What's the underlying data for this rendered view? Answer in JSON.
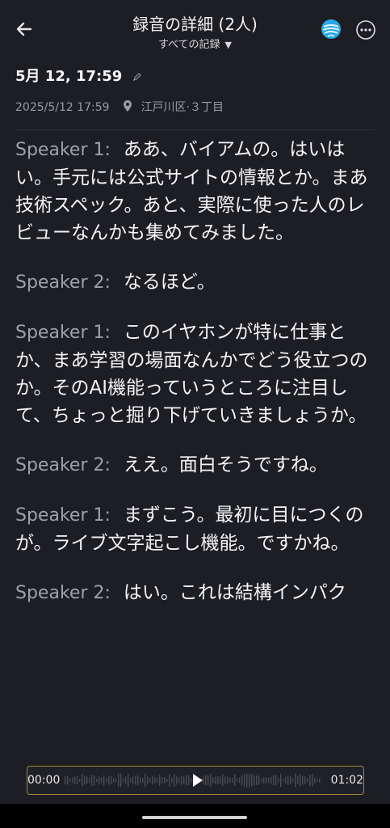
{
  "header": {
    "title": "録音の詳細 (2人)",
    "subtitle": "すべての記録",
    "icons": [
      "back-arrow-icon",
      "caret-down-icon",
      "app-logo-icon",
      "more-icon"
    ]
  },
  "recording": {
    "title": "5月 12, 17:59",
    "datetime": "2025/5/12 17:59",
    "location": "江戸川区·３丁目"
  },
  "transcript": [
    {
      "speaker": "Speaker 1:",
      "text": "ああ、バイアムの。はいはい。手元には公式サイトの情報とか。まあ技術スペック。あと、実際に使った人のレビューなんかも集めてみました。"
    },
    {
      "speaker": "Speaker 2:",
      "text": "なるほど。"
    },
    {
      "speaker": "Speaker 1:",
      "text": "このイヤホンが特に仕事とか、まあ学習の場面なんかでどう役立つのか。そのAI機能っていうところに注目して、ちょっと掘り下げていきましょうか。"
    },
    {
      "speaker": "Speaker 2:",
      "text": "ええ。面白そうですね。"
    },
    {
      "speaker": "Speaker 1:",
      "text": "まずこう。最初に目につくのが。ライブ文字起こし機能。ですかね。"
    },
    {
      "speaker": "Speaker 2:",
      "text": "はい。これは結構インパク"
    }
  ],
  "player": {
    "current_time": "00:00",
    "duration": "01:02",
    "progress": 0
  },
  "colors": {
    "background": "#1d1e23",
    "speaker_label": "#9fa1a9",
    "player_border": "#a3873c",
    "logo": "#2aa7e6"
  }
}
